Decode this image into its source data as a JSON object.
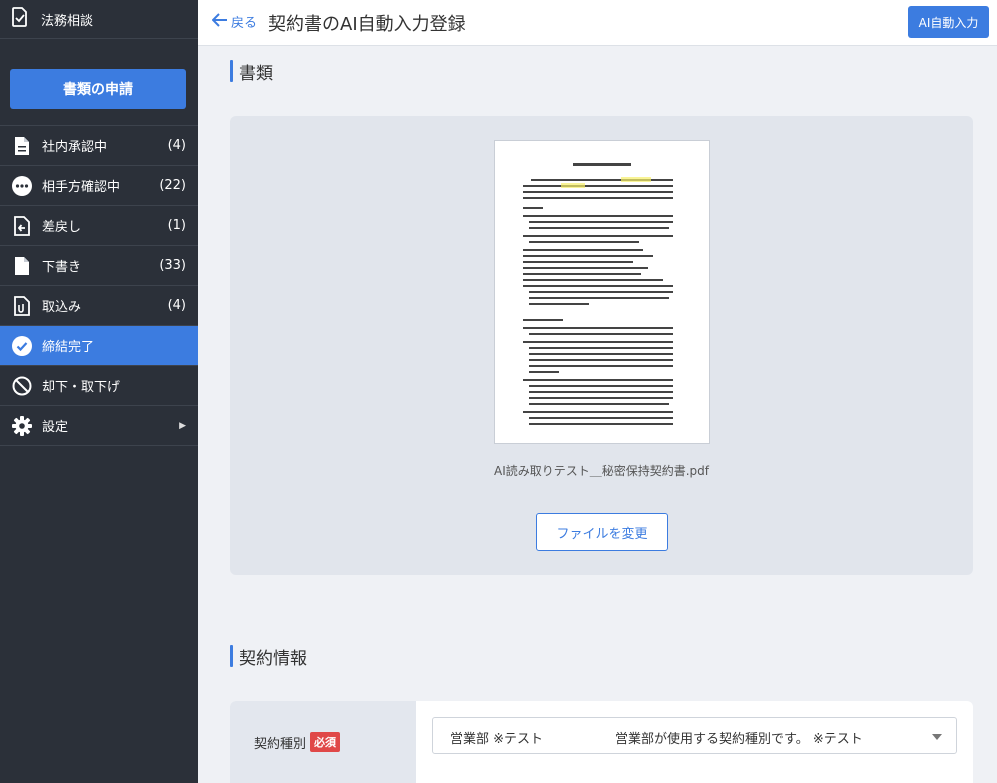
{
  "sidebar": {
    "top_item": {
      "label": "法務相談",
      "icon": "doc-check-icon"
    },
    "apply_button": "書類の申請",
    "items": [
      {
        "label": "社内承認中",
        "count": "(4)",
        "icon": "document-icon"
      },
      {
        "label": "相手方確認中",
        "count": "(22)",
        "icon": "more-dots-icon"
      },
      {
        "label": "差戻し",
        "count": "(1)",
        "icon": "return-doc-icon"
      },
      {
        "label": "下書き",
        "count": "(33)",
        "icon": "draft-doc-icon"
      },
      {
        "label": "取込み",
        "count": "(4)",
        "icon": "attach-doc-icon"
      },
      {
        "label": "締結完了",
        "count": "",
        "icon": "check-circle-icon",
        "active": true
      },
      {
        "label": "却下・取下げ",
        "count": "",
        "icon": "block-icon"
      },
      {
        "label": "設定",
        "count": "",
        "icon": "gear-icon",
        "has_submenu": true
      }
    ]
  },
  "header": {
    "back_label": "戻る",
    "title": "契約書のAI自動入力登録",
    "ai_button": "AI自動入力"
  },
  "documents": {
    "heading": "書類",
    "file_name": "AI読み取りテスト＿秘密保持契約書.pdf",
    "change_button": "ファイルを変更"
  },
  "contract_info": {
    "heading": "契約情報",
    "field_label": "契約種別",
    "required_badge": "必須",
    "selected_value": "営業部 ※テスト",
    "selected_description": "営業部が使用する契約種別です。 ※テスト"
  },
  "colors": {
    "accent": "#3c7ce0",
    "sidebar_bg": "#2b3039",
    "required": "#e04848"
  }
}
